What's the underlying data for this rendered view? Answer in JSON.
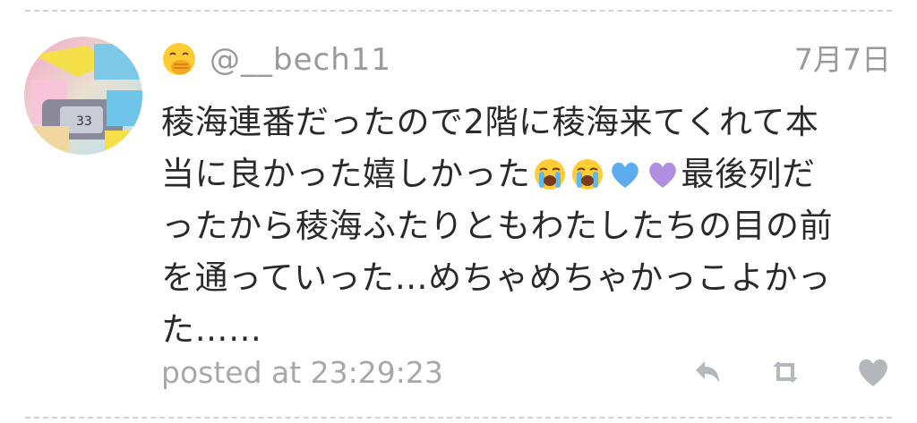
{
  "tweet": {
    "username": "@__bech11",
    "date": "7月7日",
    "lines": [
      "稜海連番だったので2階に稜海来てくれて本",
      [
        "当に良かった嬉しかった",
        "😭😭💙💜",
        "最後列だ"
      ],
      "ったから稜海ふたりともわたしたちの目の前",
      "を通っていった…めちゃめちゃかっこよかっ",
      "た……"
    ],
    "posted_prefix": "posted at",
    "posted_time": "23:29:23",
    "icons": {
      "face": "face-with-hand-over-mouth-icon",
      "emojis": [
        "loudly-crying-face-icon",
        "loudly-crying-face-icon",
        "blue-heart-icon",
        "purple-heart-icon"
      ],
      "actions": [
        "reply-icon",
        "retweet-icon",
        "heart-icon"
      ]
    },
    "colors": {
      "text": "#2a2a2a",
      "meta": "#9a9a9a",
      "action_icon": "#b4b8bd",
      "divider": "#d2d2d2"
    }
  },
  "display": {
    "line1": "稜海連番だったので2階に稜海来てくれて本",
    "line2a": "当に良かった嬉しかった",
    "line2b": "最後列だ",
    "line3": "ったから稜海ふたりともわたしたちの目の前",
    "line4": "を通っていった…めちゃめちゃかっこよかっ",
    "line5": "た……",
    "posted": "posted at 23:29:23"
  }
}
